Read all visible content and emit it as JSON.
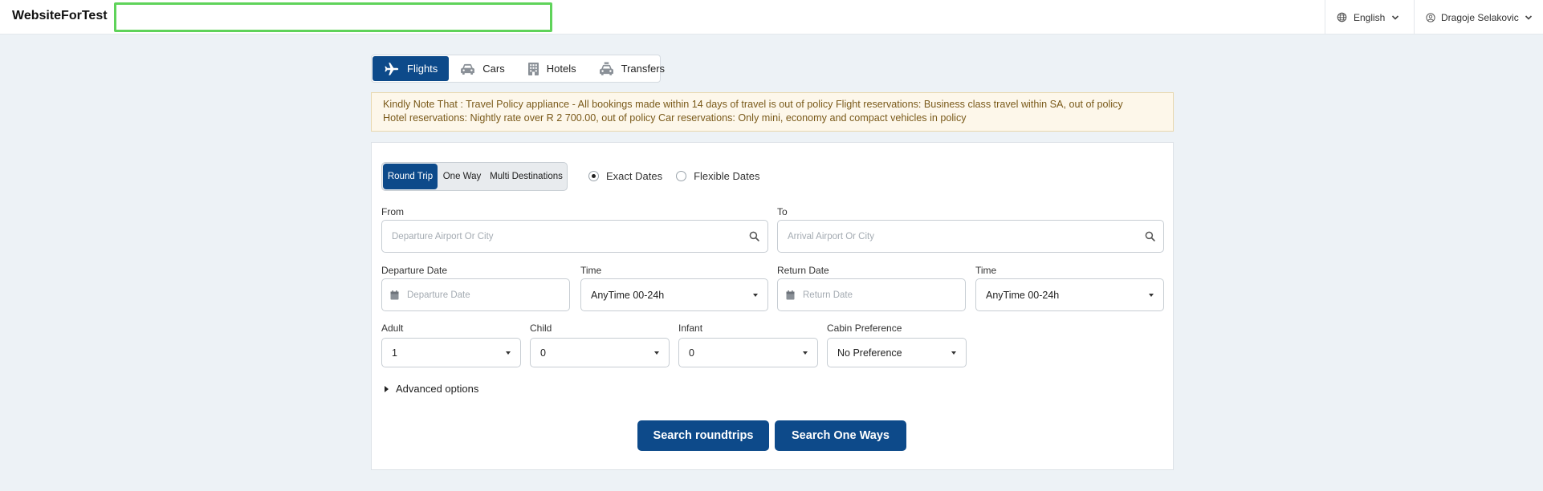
{
  "app": {
    "brand": "WebsiteForTest"
  },
  "header": {
    "search_value": "",
    "language": "English",
    "user_name": "Dragoje Selakovic"
  },
  "service_tabs": [
    {
      "label": "Flights",
      "icon": "airplane-icon",
      "active": true
    },
    {
      "label": "Cars",
      "icon": "car-icon",
      "active": false
    },
    {
      "label": "Hotels",
      "icon": "hotel-icon",
      "active": false
    },
    {
      "label": "Transfers",
      "icon": "taxi-icon",
      "active": false
    }
  ],
  "notice": {
    "line1": "Kindly Note That : Travel Policy appliance - All bookings made within 14 days of travel is out of policy Flight reservations: Business class travel within SA, out of policy",
    "line2": "Hotel reservations: Nightly rate over R 2 700.00, out of policy Car reservations: Only mini, economy and compact vehicles in policy"
  },
  "trip_types": [
    {
      "label": "Round Trip",
      "active": true
    },
    {
      "label": "One Way",
      "active": false
    },
    {
      "label": "Multi Destinations",
      "active": false
    }
  ],
  "date_mode": {
    "exact": "Exact Dates",
    "flexible": "Flexible Dates",
    "selected": "exact"
  },
  "form": {
    "from": {
      "label": "From",
      "placeholder": "Departure Airport Or City",
      "value": ""
    },
    "to": {
      "label": "To",
      "placeholder": "Arrival Airport Or City",
      "value": ""
    },
    "departure_date": {
      "label": "Departure Date",
      "placeholder": "Departure Date",
      "value": ""
    },
    "departure_time": {
      "label": "Time",
      "value": "AnyTime 00-24h"
    },
    "return_date": {
      "label": "Return Date",
      "placeholder": "Return Date",
      "value": ""
    },
    "return_time": {
      "label": "Time",
      "value": "AnyTime 00-24h"
    },
    "adult": {
      "label": "Adult",
      "value": "1"
    },
    "child": {
      "label": "Child",
      "value": "0"
    },
    "infant": {
      "label": "Infant",
      "value": "0"
    },
    "cabin": {
      "label": "Cabin Preference",
      "value": "No Preference"
    }
  },
  "advanced_options": "Advanced options",
  "buttons": {
    "search_roundtrips": "Search roundtrips",
    "search_one_ways": "Search One Ways"
  },
  "colors": {
    "primary": "#0d4a8a",
    "highlight": "#5fd35a",
    "notice_bg": "#fdf7ea",
    "notice_text": "#7a5a1a"
  }
}
